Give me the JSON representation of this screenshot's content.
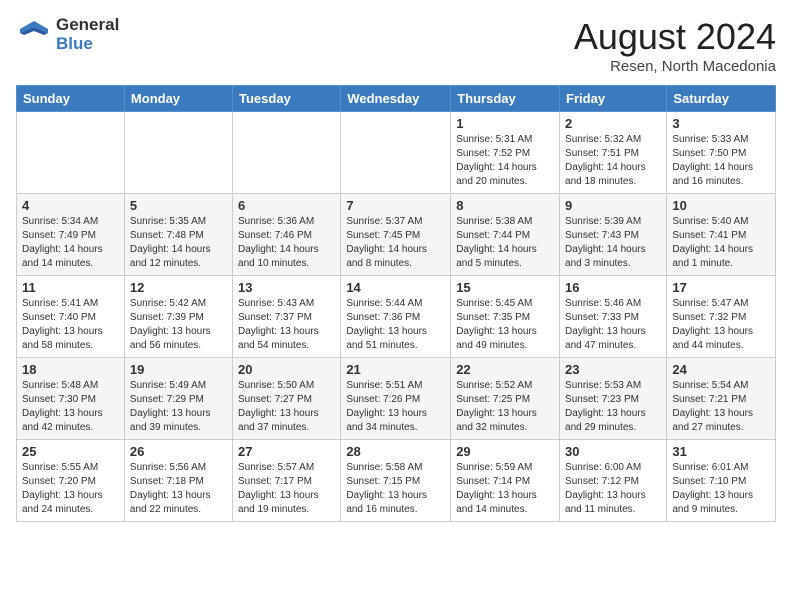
{
  "logo": {
    "general": "General",
    "blue": "Blue"
  },
  "title": {
    "month_year": "August 2024",
    "location": "Resen, North Macedonia"
  },
  "weekdays": [
    "Sunday",
    "Monday",
    "Tuesday",
    "Wednesday",
    "Thursday",
    "Friday",
    "Saturday"
  ],
  "weeks": [
    [
      {
        "day": "",
        "info": ""
      },
      {
        "day": "",
        "info": ""
      },
      {
        "day": "",
        "info": ""
      },
      {
        "day": "",
        "info": ""
      },
      {
        "day": "1",
        "info": "Sunrise: 5:31 AM\nSunset: 7:52 PM\nDaylight: 14 hours and 20 minutes."
      },
      {
        "day": "2",
        "info": "Sunrise: 5:32 AM\nSunset: 7:51 PM\nDaylight: 14 hours and 18 minutes."
      },
      {
        "day": "3",
        "info": "Sunrise: 5:33 AM\nSunset: 7:50 PM\nDaylight: 14 hours and 16 minutes."
      }
    ],
    [
      {
        "day": "4",
        "info": "Sunrise: 5:34 AM\nSunset: 7:49 PM\nDaylight: 14 hours and 14 minutes."
      },
      {
        "day": "5",
        "info": "Sunrise: 5:35 AM\nSunset: 7:48 PM\nDaylight: 14 hours and 12 minutes."
      },
      {
        "day": "6",
        "info": "Sunrise: 5:36 AM\nSunset: 7:46 PM\nDaylight: 14 hours and 10 minutes."
      },
      {
        "day": "7",
        "info": "Sunrise: 5:37 AM\nSunset: 7:45 PM\nDaylight: 14 hours and 8 minutes."
      },
      {
        "day": "8",
        "info": "Sunrise: 5:38 AM\nSunset: 7:44 PM\nDaylight: 14 hours and 5 minutes."
      },
      {
        "day": "9",
        "info": "Sunrise: 5:39 AM\nSunset: 7:43 PM\nDaylight: 14 hours and 3 minutes."
      },
      {
        "day": "10",
        "info": "Sunrise: 5:40 AM\nSunset: 7:41 PM\nDaylight: 14 hours and 1 minute."
      }
    ],
    [
      {
        "day": "11",
        "info": "Sunrise: 5:41 AM\nSunset: 7:40 PM\nDaylight: 13 hours and 58 minutes."
      },
      {
        "day": "12",
        "info": "Sunrise: 5:42 AM\nSunset: 7:39 PM\nDaylight: 13 hours and 56 minutes."
      },
      {
        "day": "13",
        "info": "Sunrise: 5:43 AM\nSunset: 7:37 PM\nDaylight: 13 hours and 54 minutes."
      },
      {
        "day": "14",
        "info": "Sunrise: 5:44 AM\nSunset: 7:36 PM\nDaylight: 13 hours and 51 minutes."
      },
      {
        "day": "15",
        "info": "Sunrise: 5:45 AM\nSunset: 7:35 PM\nDaylight: 13 hours and 49 minutes."
      },
      {
        "day": "16",
        "info": "Sunrise: 5:46 AM\nSunset: 7:33 PM\nDaylight: 13 hours and 47 minutes."
      },
      {
        "day": "17",
        "info": "Sunrise: 5:47 AM\nSunset: 7:32 PM\nDaylight: 13 hours and 44 minutes."
      }
    ],
    [
      {
        "day": "18",
        "info": "Sunrise: 5:48 AM\nSunset: 7:30 PM\nDaylight: 13 hours and 42 minutes."
      },
      {
        "day": "19",
        "info": "Sunrise: 5:49 AM\nSunset: 7:29 PM\nDaylight: 13 hours and 39 minutes."
      },
      {
        "day": "20",
        "info": "Sunrise: 5:50 AM\nSunset: 7:27 PM\nDaylight: 13 hours and 37 minutes."
      },
      {
        "day": "21",
        "info": "Sunrise: 5:51 AM\nSunset: 7:26 PM\nDaylight: 13 hours and 34 minutes."
      },
      {
        "day": "22",
        "info": "Sunrise: 5:52 AM\nSunset: 7:25 PM\nDaylight: 13 hours and 32 minutes."
      },
      {
        "day": "23",
        "info": "Sunrise: 5:53 AM\nSunset: 7:23 PM\nDaylight: 13 hours and 29 minutes."
      },
      {
        "day": "24",
        "info": "Sunrise: 5:54 AM\nSunset: 7:21 PM\nDaylight: 13 hours and 27 minutes."
      }
    ],
    [
      {
        "day": "25",
        "info": "Sunrise: 5:55 AM\nSunset: 7:20 PM\nDaylight: 13 hours and 24 minutes."
      },
      {
        "day": "26",
        "info": "Sunrise: 5:56 AM\nSunset: 7:18 PM\nDaylight: 13 hours and 22 minutes."
      },
      {
        "day": "27",
        "info": "Sunrise: 5:57 AM\nSunset: 7:17 PM\nDaylight: 13 hours and 19 minutes."
      },
      {
        "day": "28",
        "info": "Sunrise: 5:58 AM\nSunset: 7:15 PM\nDaylight: 13 hours and 16 minutes."
      },
      {
        "day": "29",
        "info": "Sunrise: 5:59 AM\nSunset: 7:14 PM\nDaylight: 13 hours and 14 minutes."
      },
      {
        "day": "30",
        "info": "Sunrise: 6:00 AM\nSunset: 7:12 PM\nDaylight: 13 hours and 11 minutes."
      },
      {
        "day": "31",
        "info": "Sunrise: 6:01 AM\nSunset: 7:10 PM\nDaylight: 13 hours and 9 minutes."
      }
    ]
  ]
}
